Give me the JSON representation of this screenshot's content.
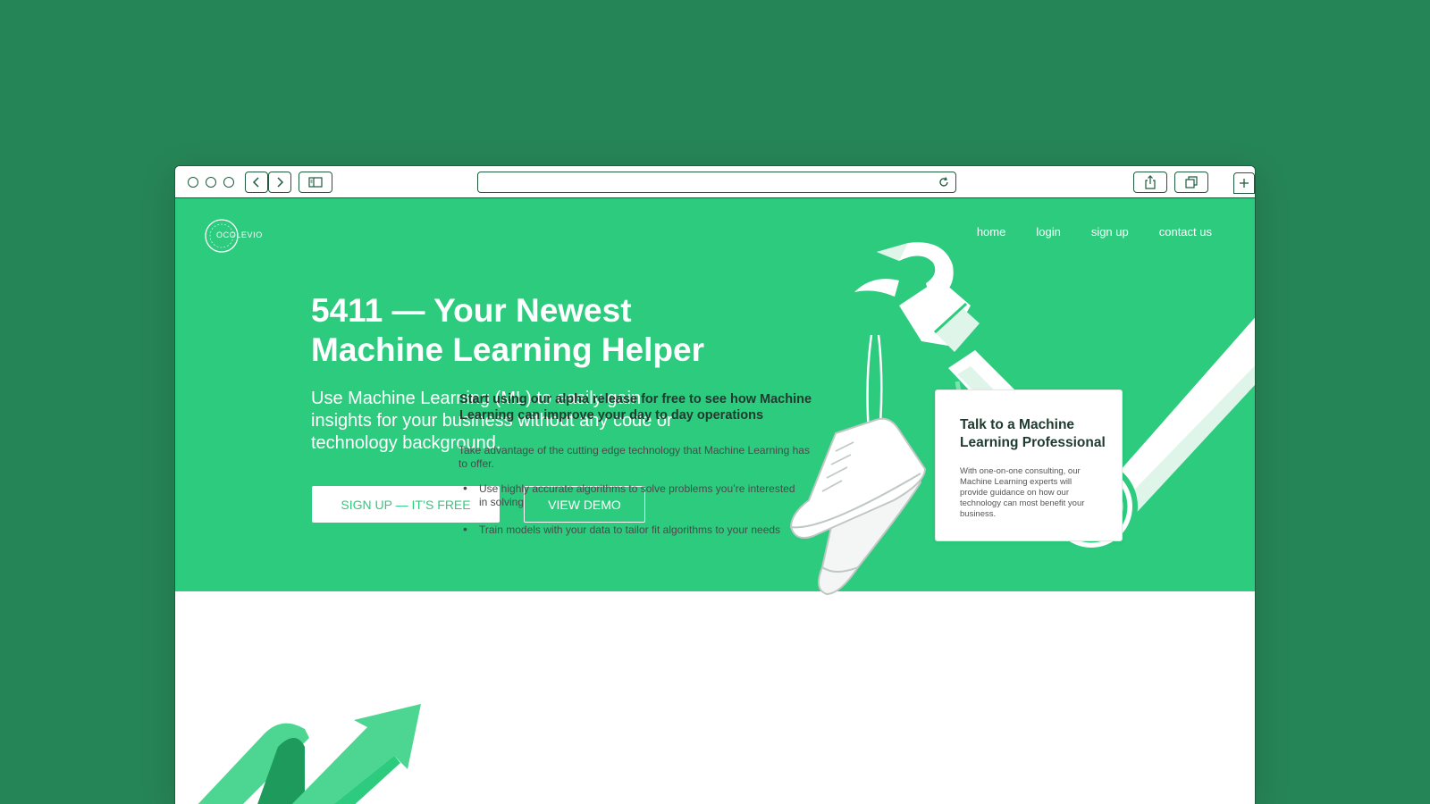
{
  "browser": {
    "toolbar": {
      "traffic_lights": [
        "close",
        "minimize",
        "zoom"
      ],
      "url": "",
      "icons": [
        "chevron-left-icon",
        "chevron-right-icon",
        "sidebar-icon",
        "reload-icon",
        "share-icon",
        "tabs-icon",
        "plus-icon"
      ]
    }
  },
  "header": {
    "logo_text": "OCOLEVIO",
    "nav": [
      "home",
      "login",
      "sign up",
      "contact us"
    ]
  },
  "hero": {
    "title_line1": "5411 — Your Newest",
    "title_line2": "Machine Learning Helper",
    "subtitle": "Use Machine Learning (ML) to easily gain insights for your business without any code or technology background.",
    "primary_cta": "SIGN UP — IT’S FREE",
    "secondary_cta": "VIEW DEMO"
  },
  "features": {
    "heading": "Start using our alpha release for free to see how Machine Learning can improve your day to day operations",
    "intro": "Take advantage of the cutting edge technology that Machine Learning has to offer.",
    "bullets": [
      "Use highly accurate algorithms to solve problems you’re interested in solving",
      "Train models with your data to tailor fit algorithms to your needs"
    ]
  },
  "card": {
    "title": "Talk to a Machine Learning Professional",
    "body": "With one-on-one consulting, our Machine Learning experts will provide guidance on how our technology can most benefit your business."
  },
  "colors": {
    "page_bg": "#268556",
    "hero_bg": "#2ccb7e",
    "frame": "#1d5c3c",
    "text_dark": "#1f3a2e"
  }
}
